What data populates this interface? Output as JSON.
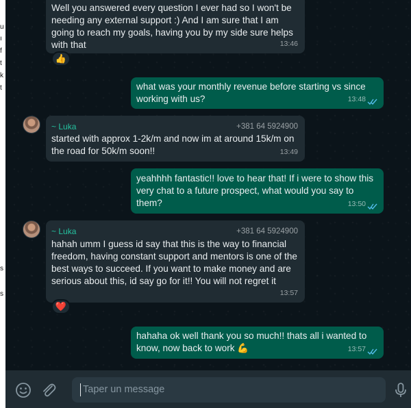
{
  "left_strip_glyphs": [
    "u",
    "ı",
    "f",
    "t",
    "k",
    "t",
    "s",
    "s"
  ],
  "messages": [
    {
      "direction": "in",
      "lines": [
        "Well you answered every question I ever had so I won't be",
        "needing any external support :) And I am sure that I am",
        "going to reach my goals, having you by my side sure helps",
        "with that"
      ],
      "time": "13:46",
      "reaction": "👍"
    },
    {
      "direction": "out",
      "lines": [
        "what was your monthly revenue before starting vs since",
        "working with us?"
      ],
      "time": "13:48",
      "status": "read"
    },
    {
      "direction": "in",
      "sender": "~ Luka",
      "phone": "+381 64 5924900",
      "lines": [
        "started with approx 1-2k/m and now im at around 15k/m on",
        "the road for 50k/m soon!!"
      ],
      "time": "13:49"
    },
    {
      "direction": "out",
      "lines": [
        "yeahhhh fantastic!! love to hear that! If i were to show this",
        "very chat to a future prospect, what would you say to them?"
      ],
      "time": "13:50",
      "status": "read"
    },
    {
      "direction": "in",
      "sender": "~ Luka",
      "phone": "+381 64 5924900",
      "lines": [
        "hahah umm I guess id say that this is the way to financial",
        "freedom, having constant support and mentors is one of the",
        "best ways to succeed. If you want to make money and are",
        "serious about this, id say go for it!! You will not regret it"
      ],
      "time": "13:57",
      "reaction": "❤️"
    },
    {
      "direction": "out",
      "lines": [
        "hahaha ok well thank you so much!! thats all i wanted to",
        "know, now back to work 💪"
      ],
      "time": "13:57",
      "status": "read"
    }
  ],
  "composer": {
    "placeholder": "Taper un message"
  },
  "icons": {
    "emoji": "emoji-icon",
    "attach": "paperclip-icon",
    "mic": "microphone-icon"
  },
  "colors": {
    "incoming": "#202c33",
    "outgoing": "#005c4b",
    "sender": "#25c2a0",
    "read_ticks": "#53bdeb"
  }
}
